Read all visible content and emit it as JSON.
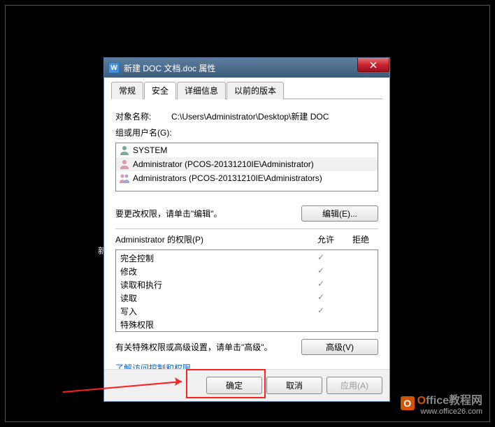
{
  "desktop_label": "新",
  "dialog": {
    "title": "新建 DOC 文档.doc 属性",
    "tabs": {
      "general": "常规",
      "security": "安全",
      "details": "详细信息",
      "previous": "以前的版本"
    },
    "object": {
      "label": "对象名称:",
      "value": "C:\\Users\\Administrator\\Desktop\\新建 DOC"
    },
    "groups_label": "组或用户名(G):",
    "users": {
      "u0": "SYSTEM",
      "u1": "Administrator (PCOS-20131210IE\\Administrator)",
      "u2": "Administrators (PCOS-20131210IE\\Administrators)"
    },
    "change_text": "要更改权限，请单击\"编辑\"。",
    "edit_btn": "编辑(E)...",
    "perms_label": "Administrator 的权限(P)",
    "allow": "允许",
    "deny": "拒绝",
    "perms": {
      "p0": "完全控制",
      "p1": "修改",
      "p2": "读取和执行",
      "p3": "读取",
      "p4": "写入",
      "p5": "特殊权限"
    },
    "check": "✓",
    "advanced_text": "有关特殊权限或高级设置，请单击\"高级\"。",
    "advanced_btn": "高级(V)",
    "link": "了解访问控制和权限",
    "buttons": {
      "ok": "确定",
      "cancel": "取消",
      "apply": "应用(A)"
    }
  },
  "watermark": {
    "brand_o": "O",
    "brand_rest": "ffice教程网",
    "url": "www.office26.com"
  }
}
